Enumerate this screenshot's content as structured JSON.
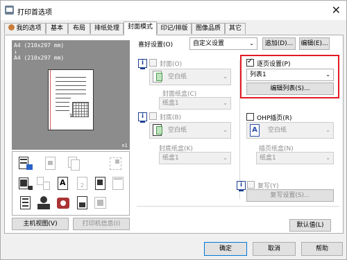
{
  "window": {
    "title": "打印首选项"
  },
  "tabs": [
    {
      "label": "我的选项"
    },
    {
      "label": "基本"
    },
    {
      "label": "布局"
    },
    {
      "label": "排纸处理"
    },
    {
      "label": "封面模式"
    },
    {
      "label": "印记/排版"
    },
    {
      "label": "图像品质"
    },
    {
      "label": "其它"
    }
  ],
  "preview": {
    "line1": "A4 (210x297 mm)",
    "arrow": "↓",
    "line2": "A4 (210x297 mm)",
    "page_number": "1",
    "zoom": "x1"
  },
  "bottom_left": {
    "printer_view": "主机视图(V)",
    "printer_info": "打印机信息(I)"
  },
  "favorites": {
    "label": "喜好设置(O)",
    "value": "自定义设置",
    "add_button": "追加(D)...",
    "edit_button": "编辑(E)..."
  },
  "front_cover": {
    "label": "封面(O)",
    "paper": "空白纸",
    "tray_label": "封面纸盒(C)",
    "tray_value": "纸盒1"
  },
  "back_cover": {
    "label": "封底(B)",
    "paper": "空白纸",
    "tray_label": "封底纸盒(K)",
    "tray_value": "纸盒1"
  },
  "per_page": {
    "label": "逐页设置(P)",
    "list_value": "列表1",
    "edit_list_button": "编辑列表(S)..."
  },
  "ohp": {
    "label": "OHP插页(R)",
    "paper": "空白纸",
    "tray_label": "插页纸盒(N)",
    "tray_value": "纸盒1"
  },
  "duplicate": {
    "label": "复写(Y)",
    "settings_button": "复写设置(S)..."
  },
  "defaults_button": "默认值(L)",
  "footer": {
    "ok": "确定",
    "cancel": "取消",
    "help": "帮助"
  },
  "colors": {
    "highlight": "#e21a23",
    "accent": "#0078d7"
  }
}
